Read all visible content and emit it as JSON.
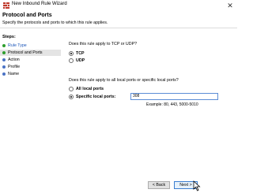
{
  "window": {
    "title": "New Inbound Rule Wizard",
    "close_glyph": "✕"
  },
  "header": {
    "title": "Protocol and Ports",
    "description": "Specify the protocols and ports to which this rule applies."
  },
  "sidebar": {
    "steps_label": "Steps:",
    "items": [
      {
        "label": "Rule Type",
        "state": "done"
      },
      {
        "label": "Protocol and Ports",
        "state": "current"
      },
      {
        "label": "Action",
        "state": "pending"
      },
      {
        "label": "Profile",
        "state": "pending"
      },
      {
        "label": "Name",
        "state": "pending"
      }
    ]
  },
  "protocol": {
    "question": "Does this rule apply to TCP or UDP?",
    "options": [
      {
        "label": "TCP",
        "checked": true
      },
      {
        "label": "UDP",
        "checked": false
      }
    ]
  },
  "ports": {
    "question": "Does this rule apply to all local ports or specific local ports?",
    "options": [
      {
        "label": "All local ports",
        "checked": false
      },
      {
        "label": "Specific local ports:",
        "checked": true
      }
    ],
    "value": "308",
    "example": "Example: 80, 443, 5000-5010"
  },
  "footer": {
    "back_label": "< Back",
    "next_label": "Next >"
  },
  "colors": {
    "done_dot": "#2e9e2e",
    "pending_dot": "#4a72c4",
    "link_text": "#1a55b8",
    "input_border": "#5b8dd6"
  }
}
